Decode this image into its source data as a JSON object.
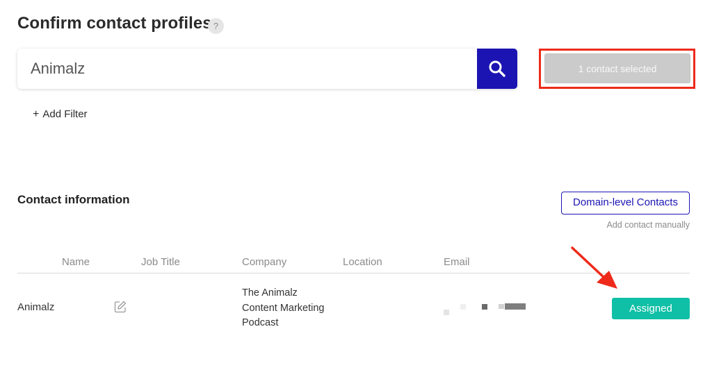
{
  "header": {
    "title": "Confirm contact profiles",
    "help_icon": "question-icon",
    "help_glyph": "?"
  },
  "search": {
    "value": "Animalz",
    "placeholder": "",
    "button_icon": "search-icon"
  },
  "selection": {
    "label": "1 contact selected",
    "highlight_color": "#ee2a1b"
  },
  "filters": {
    "plus": "+",
    "add_label": "Add Filter"
  },
  "contacts": {
    "title": "Contact information",
    "domain_button_label": "Domain-level Contacts",
    "add_manual_label": "Add contact manually",
    "columns": [
      "Name",
      "Job Title",
      "Company",
      "Location",
      "Email"
    ],
    "rows": [
      {
        "name": "Animalz",
        "job_title": "",
        "company_lines": [
          "The Animalz",
          "Content Marketing",
          "Podcast"
        ],
        "location": "",
        "email_redacted": true,
        "status_label": "Assigned"
      }
    ]
  },
  "colors": {
    "brand": "#1c14b2",
    "assigned": "#0fbfa6",
    "annotation": "#ee2a1b"
  },
  "annotations": {
    "arrow_icon": "red-arrow-icon"
  }
}
